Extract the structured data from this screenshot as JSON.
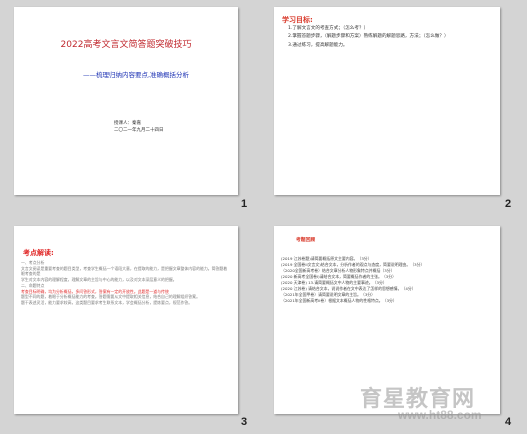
{
  "slides": [
    {
      "number": "1",
      "title": "2022高考文言文简答题突破技巧",
      "subtitle": "——梳理归纳内容要点,准确概括分析",
      "author_line1": "授课人：秦嘉",
      "author_line2": "二〇二一年九月二十四日"
    },
    {
      "number": "2",
      "heading": "学习目标:",
      "lines": [
        "1.了解文言文的考查方式；（怎么考？）",
        "2.掌握答题步骤，（解题步骤和方案）熟练解题的解题思路，方法；（怎么做？）",
        "3.通过练习，提高解题能力。"
      ]
    },
    {
      "number": "3",
      "heading": "考点解读:",
      "paragraphs": [
        "一、考点分析",
        "文言文阅读是重要考查的题目类型，考查学生概括一个语段大意，在提取的能力，是把握文章整体内容的能力。简答题着眼考查的是",
        "学生对文本内容的理解程度，理解文章的主旨与中心的能力，以及对文本深层意义的把握。",
        "二、命题特点",
        "考查目标明确，均为分析概括，多问答形式，答案有一定的开放性。此题是一道与传统",
        "题型不同的题，着眼于分析概括能力的考查。答题需要从文中提取相关信息，结合自己的理解组织答案。",
        "题干表述灵活，能力要求较高，这类题目要求考生联系文本，学会概括分析，提炼要点，规范作答。"
      ]
    },
    {
      "number": "4",
      "heading": "考题回顾",
      "lines": [
        "(2019 江苏卷题)请简要概括原文主要内容。（3分）",
        "(2019 全国卷II文言文)结合文本，分析作者的观点与态度，简要说明理由。（3分）",
        "（2020全国新高考卷）结合文章分析人物形象特点并概括（3分）",
        "(2020 新高考全国卷I)请结合文本，简要概括作者的主张。（3分）",
        "(2020 天津卷) 13.请简要概括文中人物的主要事迹。（3分）",
        "(2020 江苏卷) 请结合文本，说说作者在文中表达了怎样的思想感情。（4分）",
        "（2021年全国甲卷）请简要说明文章的主旨。（3分）",
        "（2021年全国新高考II卷）根据文本概括人物的性格特点。（3分）"
      ]
    }
  ],
  "watermark": {
    "brand": "育星教育网",
    "url": "www.ht88.com"
  }
}
